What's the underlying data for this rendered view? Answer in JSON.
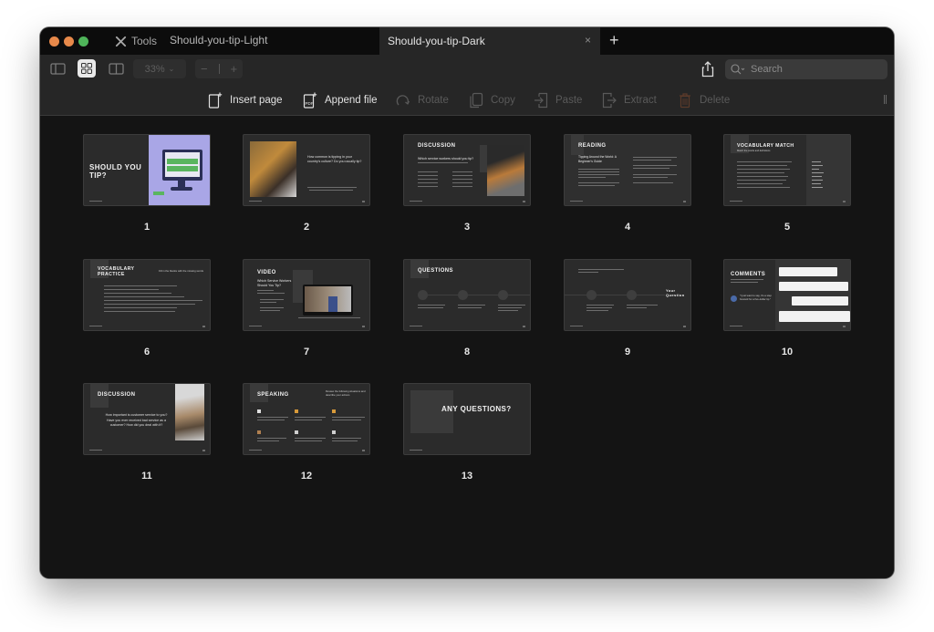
{
  "window": {
    "tools_label": "Tools",
    "tabs": [
      {
        "label": "Should-you-tip-Light",
        "active": false
      },
      {
        "label": "Should-you-tip-Dark",
        "active": true
      }
    ],
    "close_tab_glyph": "×",
    "new_tab_glyph": "+"
  },
  "toolbar": {
    "view_modes": [
      "sidebar-view",
      "grid-view",
      "two-page-view"
    ],
    "active_view": "grid-view",
    "zoom_level": "33%",
    "zoom_out_glyph": "−",
    "zoom_in_glyph": "+",
    "search_placeholder": "Search"
  },
  "actions": [
    {
      "label": "Insert page",
      "icon": "insert-page-icon",
      "enabled": true
    },
    {
      "label": "Append file",
      "icon": "append-pdf-icon",
      "enabled": true
    },
    {
      "label": "Rotate",
      "icon": "rotate-icon",
      "enabled": false
    },
    {
      "label": "Copy",
      "icon": "copy-icon",
      "enabled": false
    },
    {
      "label": "Paste",
      "icon": "paste-icon",
      "enabled": false
    },
    {
      "label": "Extract",
      "icon": "extract-icon",
      "enabled": false
    },
    {
      "label": "Delete",
      "icon": "trash-icon",
      "enabled": false
    }
  ],
  "pages": [
    {
      "number": "1",
      "title": "SHOULD YOU TIP?"
    },
    {
      "number": "2",
      "title": "",
      "text": "How common is tipping in your country's culture? Do you usually tip?"
    },
    {
      "number": "3",
      "title": "DISCUSSION",
      "text": "Which service workers should you tip?"
    },
    {
      "number": "4",
      "title": "READING",
      "text": "Tipping Around the World: A Beginner's Guide"
    },
    {
      "number": "5",
      "title": "VOCABULARY MATCH",
      "text": "Match the words and definitions"
    },
    {
      "number": "6",
      "title": "VOCABULARY PRACTICE",
      "text": "Fill in the blanks with the missing words"
    },
    {
      "number": "7",
      "title": "VIDEO",
      "text": "Which Service Workers Should You Tip?"
    },
    {
      "number": "8",
      "title": "QUESTIONS",
      "text": ""
    },
    {
      "number": "9",
      "title": "",
      "text": "Your Question"
    },
    {
      "number": "10",
      "title": "COMMENTS",
      "text": "\"I just want to say, it's a step forward for a five-dollar tip.\""
    },
    {
      "number": "11",
      "title": "DISCUSSION",
      "text": "How important is customer service to you? Have you ever received bad service as a customer? How did you deal with it?"
    },
    {
      "number": "12",
      "title": "SPEAKING",
      "text": "Review the following situations and describe your actions"
    },
    {
      "number": "13",
      "title": "ANY QUESTIONS?"
    }
  ]
}
